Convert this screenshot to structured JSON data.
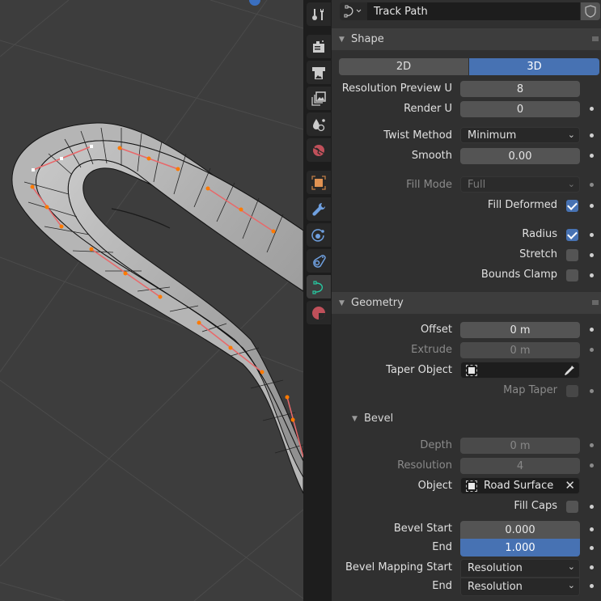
{
  "viewport": {
    "grid_color": "#4a4a4a",
    "background_color": "#3d3d3d",
    "handle_colors": {
      "selected": "#ff7a00",
      "active": "#ffffff",
      "line": "#e8686a"
    }
  },
  "tabs": [
    {
      "name": "tool",
      "icon": "tool-icon",
      "active": false
    },
    {
      "name": "render",
      "icon": "render-icon",
      "active": false
    },
    {
      "name": "output",
      "icon": "output-icon",
      "active": false
    },
    {
      "name": "view-layer",
      "icon": "view-layer-icon",
      "active": false
    },
    {
      "name": "scene",
      "icon": "scene-icon",
      "active": false
    },
    {
      "name": "world",
      "icon": "world-icon",
      "active": false
    },
    {
      "name": "object",
      "icon": "object-icon",
      "active": false
    },
    {
      "name": "modifiers",
      "icon": "wrench-icon",
      "active": false
    },
    {
      "name": "physics",
      "icon": "physics-icon",
      "active": false
    },
    {
      "name": "constraints",
      "icon": "constraints-icon",
      "active": false
    },
    {
      "name": "data",
      "icon": "curve-data-icon",
      "active": true
    },
    {
      "name": "material",
      "icon": "material-icon",
      "active": false
    }
  ],
  "header": {
    "datablock_name": "Track Path",
    "datablock_type_icon": "curve-icon",
    "fake_user_icon": "shield-icon"
  },
  "shape": {
    "title": "Shape",
    "dimension_options": [
      "2D",
      "3D"
    ],
    "dimension_selected": "3D",
    "resolution_preview_u": {
      "label": "Resolution Preview U",
      "value": "8"
    },
    "render_u": {
      "label": "Render U",
      "value": "0"
    },
    "twist_method": {
      "label": "Twist Method",
      "value": "Minimum"
    },
    "smooth": {
      "label": "Smooth",
      "value": "0.00"
    },
    "fill_mode": {
      "label": "Fill Mode",
      "value": "Full"
    },
    "fill_deformed": {
      "label": "Fill Deformed",
      "checked": true
    },
    "radius": {
      "label": "Radius",
      "checked": true
    },
    "stretch": {
      "label": "Stretch",
      "checked": false
    },
    "bounds_clamp": {
      "label": "Bounds Clamp",
      "checked": false
    }
  },
  "geometry": {
    "title": "Geometry",
    "offset": {
      "label": "Offset",
      "value": "0 m"
    },
    "extrude": {
      "label": "Extrude",
      "value": "0 m"
    },
    "taper_object": {
      "label": "Taper Object",
      "value": ""
    },
    "map_taper": {
      "label": "Map Taper",
      "checked": false
    }
  },
  "bevel": {
    "title": "Bevel",
    "depth": {
      "label": "Depth",
      "value": "0 m"
    },
    "resolution": {
      "label": "Resolution",
      "value": "4"
    },
    "object": {
      "label": "Object",
      "value": "Road Surface"
    },
    "fill_caps": {
      "label": "Fill Caps",
      "checked": false
    },
    "bevel_start": {
      "label": "Bevel Start",
      "value": "0.000"
    },
    "bevel_end": {
      "label": "End",
      "value": "1.000"
    },
    "mapping_start": {
      "label": "Bevel Mapping Start",
      "value": "Resolution"
    },
    "mapping_end": {
      "label": "End",
      "value": "Resolution"
    }
  }
}
